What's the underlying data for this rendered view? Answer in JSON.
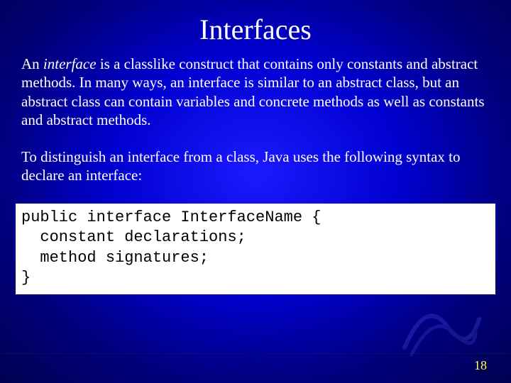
{
  "title": "Interfaces",
  "para1_pre": "An ",
  "para1_italic": "interface",
  "para1_post": " is a classlike construct that contains only constants and abstract methods. In many ways, an interface is similar to an abstract class, but an abstract class can contain variables and concrete methods as well as constants and abstract methods.",
  "para2": "To distinguish an interface from a class, Java uses the following syntax to declare an interface:",
  "code": "public interface InterfaceName {\n  constant declarations;\n  method signatures;\n}",
  "page_number": "18"
}
